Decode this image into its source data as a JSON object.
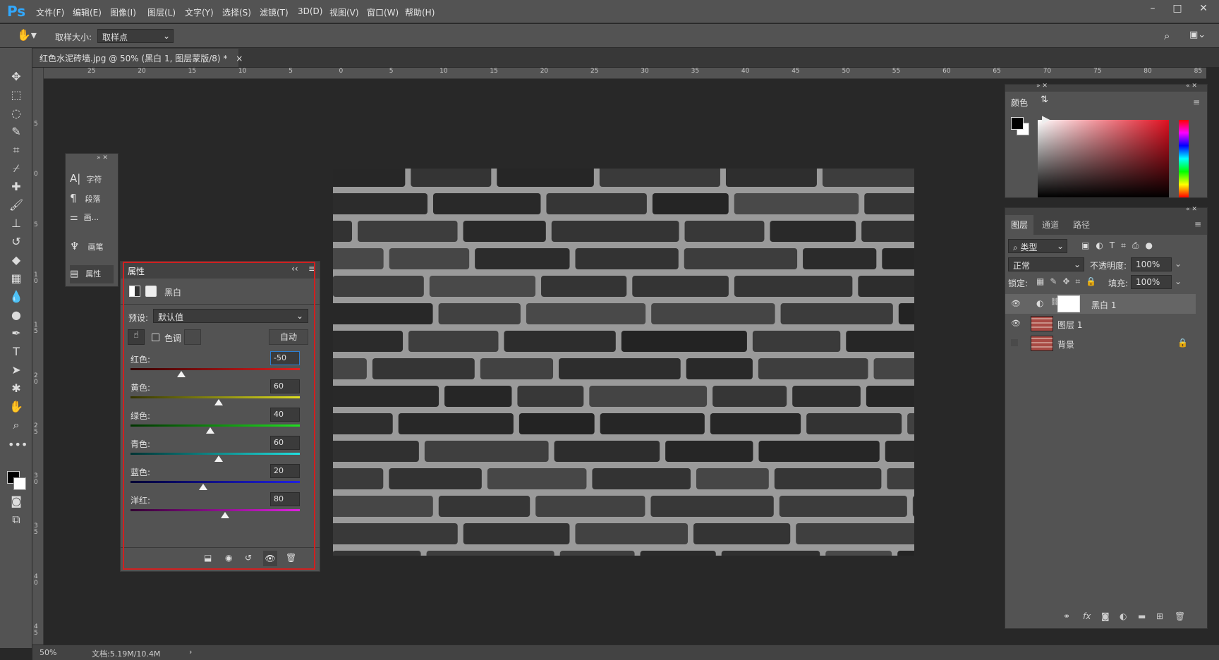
{
  "app": {
    "logo": "Ps"
  },
  "menu": [
    "文件(F)",
    "编辑(E)",
    "图像(I)",
    "图层(L)",
    "文字(Y)",
    "选择(S)",
    "滤镜(T)",
    "3D(D)",
    "视图(V)",
    "窗口(W)",
    "帮助(H)"
  ],
  "options_bar": {
    "sample_size_label": "取样大小:",
    "sample_size_value": "取样点"
  },
  "document": {
    "tab_title": "红色水泥砖墙.jpg @ 50% (黑白 1, 图层蒙版/8) *",
    "close": "×"
  },
  "ruler": {
    "h_ticks": [
      "25",
      "20",
      "15",
      "10",
      "5",
      "0",
      "5",
      "10",
      "15",
      "20",
      "25",
      "30",
      "35",
      "40",
      "45",
      "50",
      "55",
      "60",
      "65",
      "70",
      "75",
      "80",
      "85"
    ],
    "v_ticks": [
      "5",
      "0",
      "5",
      "1 0",
      "1 5",
      "2 0",
      "2 5",
      "3 0",
      "3 5",
      "4 0",
      "4 5"
    ]
  },
  "status": {
    "zoom": "50%",
    "doc_info": "文档:5.19M/10.4M",
    "arrow": "›"
  },
  "mini_panel": {
    "items": [
      "字符",
      "段落",
      "画...",
      "画笔",
      "属性"
    ]
  },
  "properties": {
    "title": "属性",
    "adjustment_name": "黑白",
    "preset_label": "预设:",
    "preset_value": "默认值",
    "tint_label": "色调",
    "auto_button": "自动",
    "sliders": [
      {
        "label": "红色:",
        "value": "-50",
        "pos": 0.3
      },
      {
        "label": "黄色:",
        "value": "60",
        "pos": 0.52
      },
      {
        "label": "绿色:",
        "value": "40",
        "pos": 0.47
      },
      {
        "label": "青色:",
        "value": "60",
        "pos": 0.52
      },
      {
        "label": "蓝色:",
        "value": "20",
        "pos": 0.43
      },
      {
        "label": "洋红:",
        "value": "80",
        "pos": 0.56
      }
    ]
  },
  "color_panel": {
    "title": "颜色"
  },
  "layers_panel": {
    "tabs": [
      "图层",
      "通道",
      "路径"
    ],
    "filter_label": "类型",
    "blend_mode": "正常",
    "opacity_label": "不透明度:",
    "opacity_value": "100%",
    "lock_label": "锁定:",
    "fill_label": "填充:",
    "fill_value": "100%",
    "layers": [
      {
        "name": "黑白 1"
      },
      {
        "name": "图层 1"
      },
      {
        "name": "背景"
      }
    ],
    "footer_fx": "fx"
  },
  "colors": {
    "accent": "#31a8ff",
    "highlight_border": "#d12020"
  }
}
